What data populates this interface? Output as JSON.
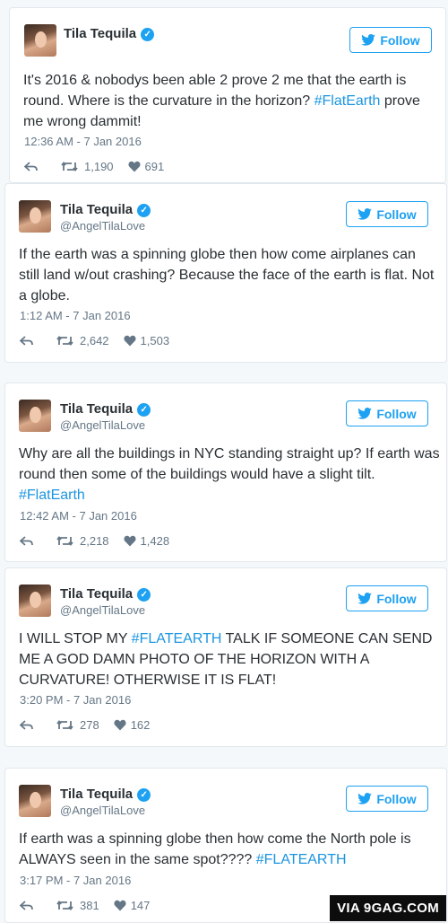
{
  "user": {
    "name": "Tila Tequila",
    "follow_label": "Follow"
  },
  "colors": {
    "accent": "#1da1f2",
    "hashtag": "#1b95e0",
    "text": "#292f33",
    "muted": "#657786"
  },
  "tweets": [
    {
      "handle": "",
      "segments": [
        {
          "text": "It's 2016 & nobodys been able 2 prove 2 me that the earth is round. Where is the curvature in the horizon? "
        },
        {
          "text": "#FlatEarth",
          "tag": true
        },
        {
          "text": " prove me wrong dammit!"
        }
      ],
      "time": "12:36 AM - 7 Jan 2016",
      "retweets": "1,190",
      "likes": "691"
    },
    {
      "handle": "@AngelTilaLove",
      "segments": [
        {
          "text": "If the earth was a spinning globe then how come airplanes can still land w/out crashing? Because the face of the earth is flat. Not a globe."
        }
      ],
      "time": "1:12 AM - 7 Jan 2016",
      "retweets": "2,642",
      "likes": "1,503"
    },
    {
      "handle": "@AngelTilaLove",
      "segments": [
        {
          "text": "Why are all the buildings in NYC standing straight up? If earth was round then some of the buildings would have a slight tilt. "
        },
        {
          "text": "#FlatEarth",
          "tag": true
        }
      ],
      "time": "12:42 AM - 7 Jan 2016",
      "retweets": "2,218",
      "likes": "1,428"
    },
    {
      "handle": "@AngelTilaLove",
      "segments": [
        {
          "text": "I WILL STOP MY "
        },
        {
          "text": "#FLATEARTH",
          "tag": true
        },
        {
          "text": " TALK IF SOMEONE CAN SEND ME A GOD DAMN PHOTO OF THE HORIZON WITH A CURVATURE! OTHERWISE IT IS FLAT!"
        }
      ],
      "time": "3:20 PM - 7 Jan 2016",
      "retweets": "278",
      "likes": "162"
    },
    {
      "handle": "@AngelTilaLove",
      "segments": [
        {
          "text": "If earth was a spinning globe then how come the North pole is ALWAYS seen in the same spot???? "
        },
        {
          "text": "#FLATEARTH",
          "tag": true
        }
      ],
      "time": "3:17 PM - 7 Jan 2016",
      "retweets": "381",
      "likes": "147"
    }
  ],
  "watermark": "VIA 9GAG.COM",
  "icons": {
    "verified": "verified-badge-icon",
    "follow": "twitter-bird-icon",
    "reply": "reply-arrow-icon",
    "retweet": "retweet-icon",
    "like": "heart-icon"
  }
}
